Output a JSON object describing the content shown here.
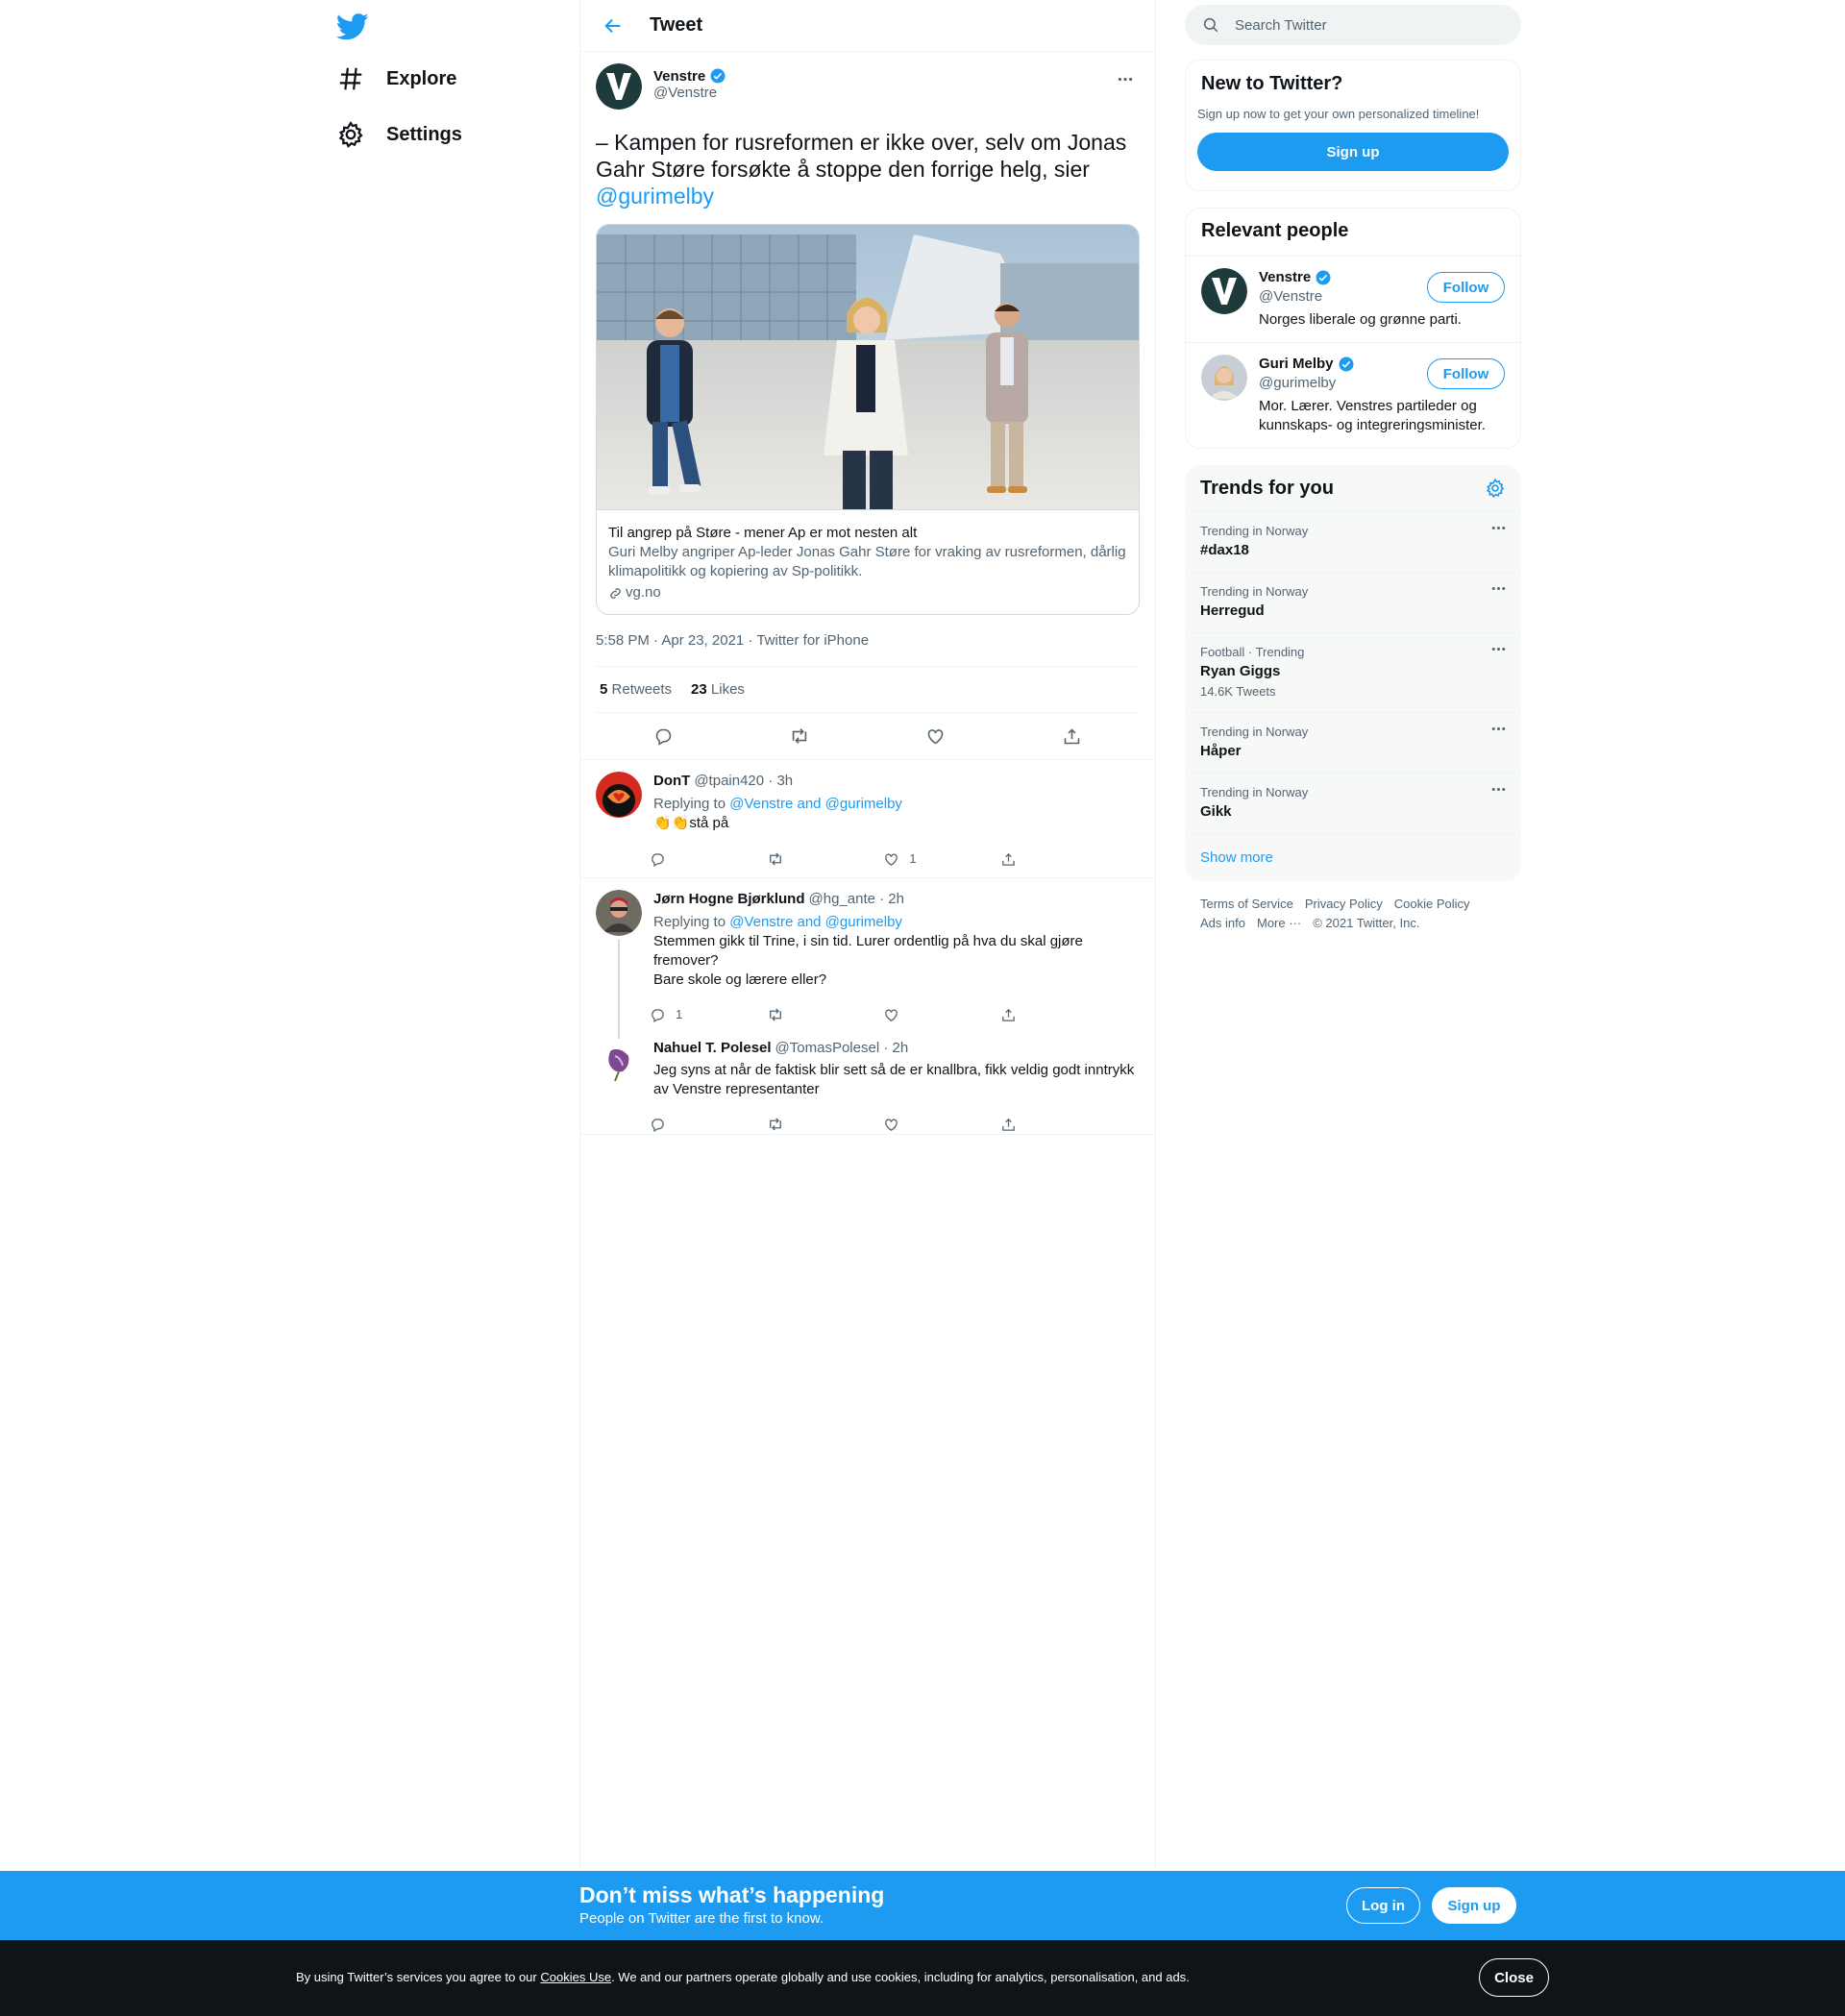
{
  "nav": {
    "logo_icon": "twitter-bird-icon",
    "items": [
      {
        "label": "Explore",
        "icon": "hashtag-icon"
      },
      {
        "label": "Settings",
        "icon": "gear-icon"
      }
    ]
  },
  "header": {
    "title": "Tweet"
  },
  "tweet": {
    "author_name": "Venstre",
    "author_handle": "@Venstre",
    "text_before": "– Kampen for rusreformen er ikke over, selv om Jonas Gahr Støre forsøkte å stoppe den forrige helg, sier ",
    "text_mention": "@gurimelby",
    "card": {
      "title": "Til angrep på Støre - mener Ap er mot nesten alt",
      "description": "Guri Melby angriper Ap-leder Jonas Gahr Støre for vraking av rusreformen, dårlig klimapolitikk og kopiering av Sp-politikk.",
      "domain": "vg.no"
    },
    "meta": "5:58 PM · Apr 23, 2021 · Twitter for iPhone",
    "retweets_count": "5",
    "retweets_label": "Retweets",
    "likes_count": "23",
    "likes_label": "Likes"
  },
  "replies": [
    {
      "name": "DonT",
      "handle_time": "@tpain420 · 3h",
      "replying_prefix": "Replying to ",
      "replying_to": "@Venstre and @gurimelby",
      "text": "👏👏stå på",
      "reply_count": "",
      "like_count": "1"
    },
    {
      "name": "Jørn Hogne Bjørklund",
      "handle_time": "@hg_ante · 2h",
      "replying_prefix": "Replying to ",
      "replying_to": "@Venstre and @gurimelby",
      "text_lines": [
        "Stemmen gikk til Trine, i sin tid. Lurer ordentlig på hva du skal gjøre fremover?",
        "Bare skole og lærere eller?"
      ],
      "reply_count": "1",
      "like_count": ""
    },
    {
      "name": "Nahuel T. Polesel",
      "handle_time": "@TomasPolesel · 2h",
      "text": "Jeg syns at når de faktisk blir sett så de er knallbra, fikk veldig godt inntrykk av Venstre representanter",
      "reply_count": "",
      "like_count": ""
    }
  ],
  "search": {
    "placeholder": "Search Twitter"
  },
  "new_to_twitter": {
    "title": "New to Twitter?",
    "subtitle": "Sign up now to get your own personalized timeline!",
    "button": "Sign up"
  },
  "relevant_people": {
    "title": "Relevant people",
    "people": [
      {
        "name": "Venstre",
        "handle": "@Venstre",
        "bio": "Norges liberale og grønne parti.",
        "button": "Follow"
      },
      {
        "name": "Guri Melby",
        "handle": "@gurimelby",
        "bio": "Mor. Lærer. Venstres partileder og kunnskaps- og integreringsminister.",
        "button": "Follow"
      }
    ]
  },
  "trends": {
    "title": "Trends for you",
    "items": [
      {
        "context": "Trending in Norway",
        "name": "#dax18",
        "count": ""
      },
      {
        "context": "Trending in Norway",
        "name": "Herregud",
        "count": ""
      },
      {
        "context": "Football · Trending",
        "name": "Ryan Giggs",
        "count": "14.6K Tweets"
      },
      {
        "context": "Trending in Norway",
        "name": "Håper",
        "count": ""
      },
      {
        "context": "Trending in Norway",
        "name": "Gikk",
        "count": ""
      }
    ],
    "show_more": "Show more"
  },
  "footer": {
    "links": [
      "Terms of Service",
      "Privacy Policy",
      "Cookie Policy",
      "Ads info",
      "More ···",
      "© 2021 Twitter, Inc."
    ]
  },
  "bottom_bar": {
    "title": "Don’t miss what’s happening",
    "subtitle": "People on Twitter are the first to know.",
    "login": "Log in",
    "signup": "Sign up"
  },
  "cookie_bar": {
    "text_before": "By using Twitter’s services you agree to our ",
    "link": "Cookies Use",
    "text_after": ". We and our partners operate globally and use cookies, including for analytics, personalisation, and ads.",
    "close": "Close"
  },
  "colors": {
    "brand": "#1d9bf0",
    "text": "#0f1419",
    "muted": "#536471",
    "cookie_bg": "#0f1419"
  }
}
